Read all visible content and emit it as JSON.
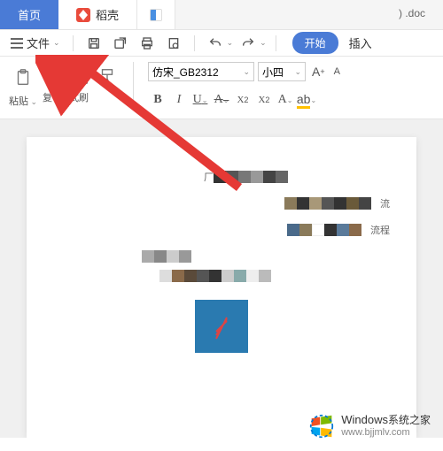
{
  "tabs": {
    "home": "首页",
    "doc_shell": "稻壳",
    "title_suffix": ") .doc"
  },
  "menu": {
    "file": "文件",
    "start": "开始",
    "insert": "插入"
  },
  "toolbar": {
    "paste": "粘贴",
    "copy": "复",
    "format_painter": "格式刷",
    "font_name": "仿宋_GB2312",
    "font_size": "小四"
  },
  "doc": {
    "text1": "厂",
    "text2": "流",
    "text3": "流程"
  },
  "watermark": {
    "main": "Windows",
    "sub1": "系统之家",
    "sub2": "www.bjjmlv.com"
  }
}
